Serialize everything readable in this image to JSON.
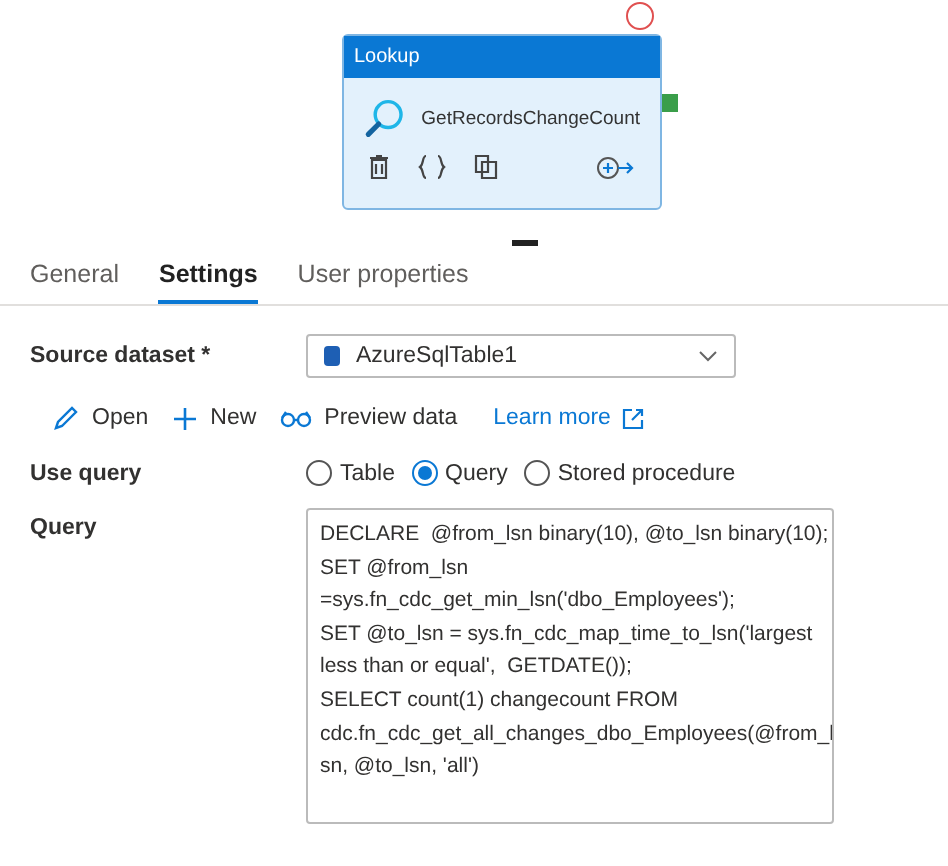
{
  "activity": {
    "type": "Lookup",
    "name": "GetRecordsChangeCount"
  },
  "tabs": [
    {
      "label": "General",
      "selected": false
    },
    {
      "label": "Settings",
      "selected": true
    },
    {
      "label": "User properties",
      "selected": false
    }
  ],
  "source_dataset": {
    "label": "Source dataset *",
    "value": "AzureSqlTable1"
  },
  "actions": [
    {
      "kind": "open",
      "label": "Open"
    },
    {
      "kind": "new",
      "label": "New"
    },
    {
      "kind": "preview",
      "label": "Preview data"
    },
    {
      "kind": "link",
      "label": "Learn more"
    }
  ],
  "use_query": {
    "label": "Use query",
    "options": [
      {
        "label": "Table",
        "selected": false
      },
      {
        "label": "Query",
        "selected": true
      },
      {
        "label": "Stored procedure",
        "selected": false
      }
    ]
  },
  "query": {
    "label": "Query",
    "value": "DECLARE  @from_lsn binary(10), @to_lsn binary(10);\nSET @from_lsn\n=sys.fn_cdc_get_min_lsn('dbo_Employees');\nSET @to_lsn = sys.fn_cdc_map_time_to_lsn('largest\nless than or equal',  GETDATE());\nSELECT count(1) changecount FROM\ncdc.fn_cdc_get_all_changes_dbo_Employees(@from_l\nsn, @to_lsn, 'all')"
  }
}
